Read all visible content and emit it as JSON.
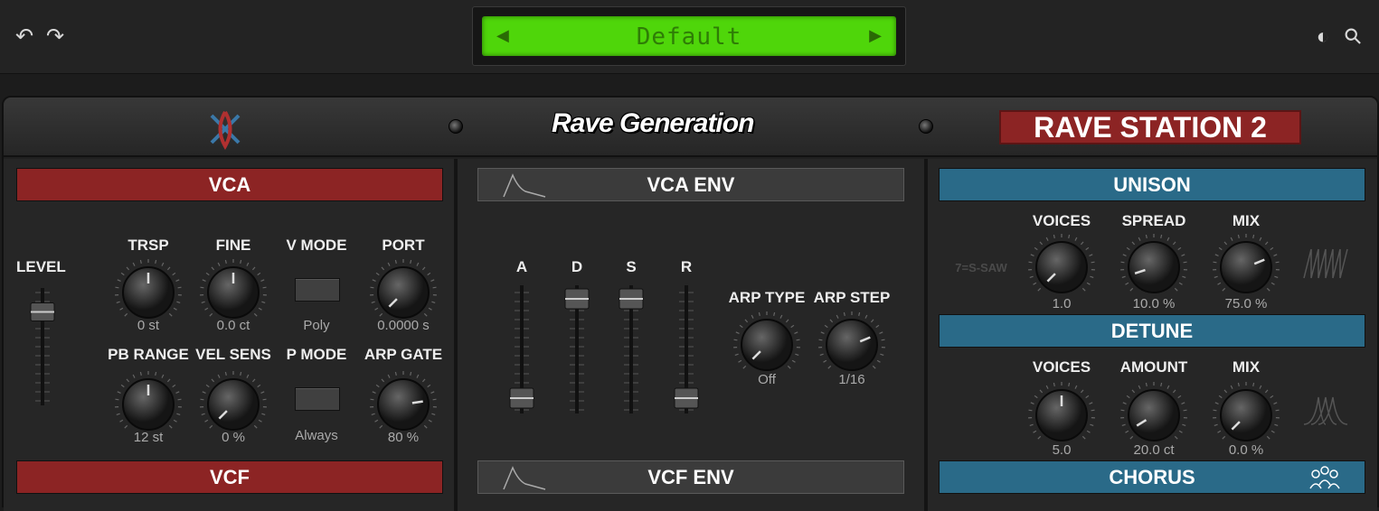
{
  "toolbar": {
    "undo_icon": "↶",
    "redo_icon": "↷",
    "contrast_icon": "◐",
    "search_icon": "⚲"
  },
  "preset": {
    "name": "Default",
    "prev": "◀",
    "next": "▶"
  },
  "header": {
    "brand": "Rave Generation",
    "product": "RAVE STATION 2"
  },
  "vca": {
    "title": "VCA",
    "level": {
      "label": "LEVEL",
      "value": 0.85
    },
    "trsp": {
      "label": "TRSP",
      "value": "0 st",
      "pos": 0.5
    },
    "fine": {
      "label": "FINE",
      "value": "0.0 ct",
      "pos": 0.5
    },
    "vmode": {
      "label": "V MODE",
      "value": "Poly"
    },
    "port": {
      "label": "PORT",
      "value": "0.0000 s",
      "pos": 0.0
    },
    "pbrange": {
      "label": "PB RANGE",
      "value": "12 st",
      "pos": 0.5
    },
    "velsens": {
      "label": "VEL SENS",
      "value": "0 %",
      "pos": 0.0
    },
    "pmode": {
      "label": "P MODE",
      "value": "Always"
    },
    "arpgate": {
      "label": "ARP GATE",
      "value": "80 %",
      "pos": 0.8
    }
  },
  "vcf": {
    "title": "VCF"
  },
  "vcaenv": {
    "title": "VCA ENV",
    "a": {
      "label": "A",
      "value": 0.0
    },
    "d": {
      "label": "D",
      "value": 1.0
    },
    "s": {
      "label": "S",
      "value": 1.0
    },
    "r": {
      "label": "R",
      "value": 0.0
    },
    "arptype": {
      "label": "ARP TYPE",
      "value": "Off",
      "pos": 0.0
    },
    "arpstep": {
      "label": "ARP STEP",
      "value": "1/16",
      "pos": 0.75
    }
  },
  "vcfenv": {
    "title": "VCF ENV"
  },
  "unison": {
    "title": "UNISON",
    "hint": "7=S-SAW",
    "voices": {
      "label": "VOICES",
      "value": "1.0",
      "pos": 0.0
    },
    "spread": {
      "label": "SPREAD",
      "value": "10.0 %",
      "pos": 0.1
    },
    "mix": {
      "label": "MIX",
      "value": "75.0 %",
      "pos": 0.75
    }
  },
  "detune": {
    "title": "DETUNE",
    "voices": {
      "label": "VOICES",
      "value": "5.0",
      "pos": 0.5
    },
    "amount": {
      "label": "AMOUNT",
      "value": "20.0 ct",
      "pos": 0.05
    },
    "mix": {
      "label": "MIX",
      "value": "0.0 %",
      "pos": 0.0
    }
  },
  "chorus": {
    "title": "CHORUS"
  },
  "colors": {
    "lcd": "#4fd60a",
    "red": "#8c2424",
    "blue": "#2a6a88"
  }
}
